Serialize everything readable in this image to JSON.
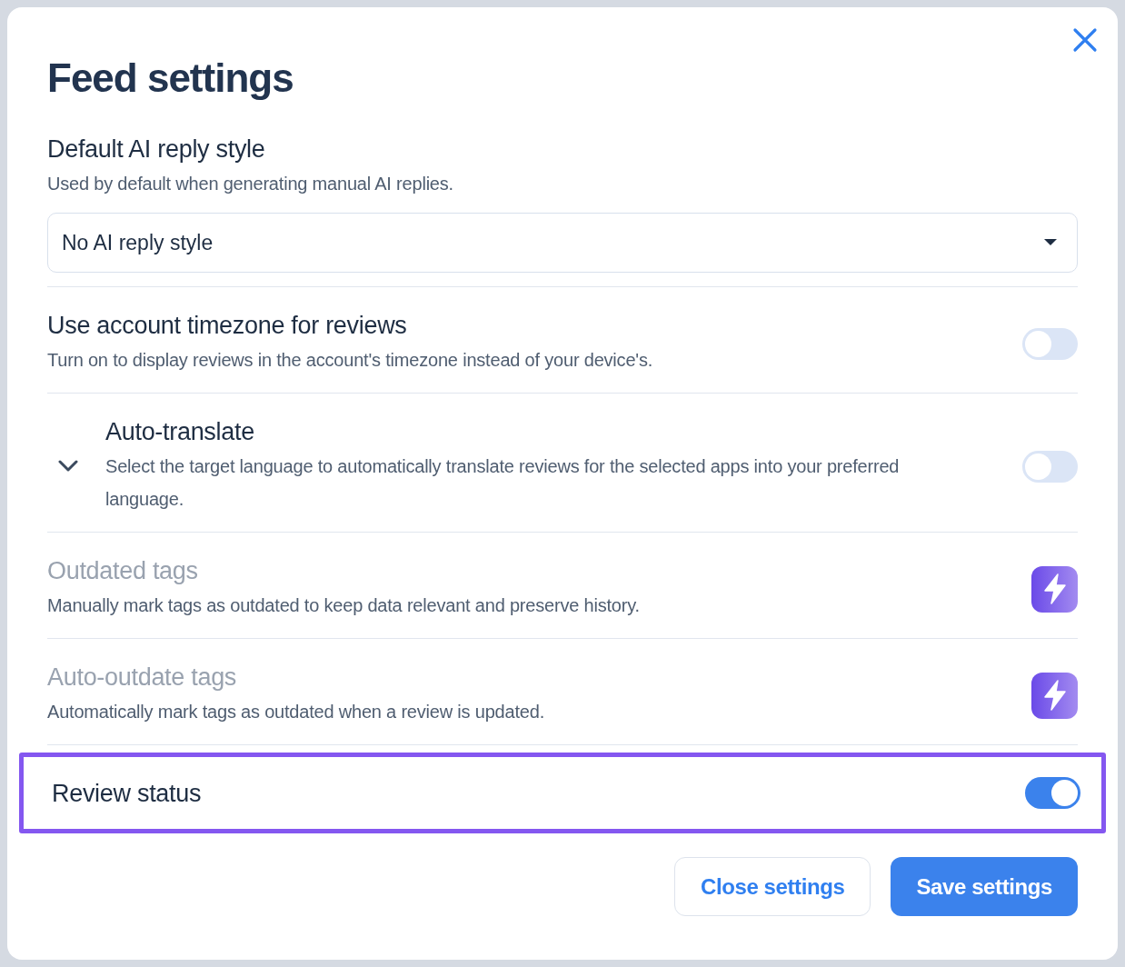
{
  "dialog": {
    "title": "Feed settings"
  },
  "reply_style": {
    "title": "Default AI reply style",
    "description": "Used by default when generating manual AI replies.",
    "value": "No AI reply style"
  },
  "settings": [
    {
      "kind": "toggle",
      "title": "Use account timezone for reviews",
      "description": "Turn on to display reviews in the account's timezone instead of your device's.",
      "on": false,
      "highlighted": false
    },
    {
      "kind": "toggle",
      "title": "Auto-translate",
      "description": "Select the target language to automatically translate reviews for the selected apps into your preferred language.",
      "on": false,
      "expanded": false,
      "highlighted": false
    },
    {
      "kind": "premium",
      "title": "Outdated tags",
      "description": "Manually mark tags as outdated to keep data relevant and preserve history.",
      "highlighted": false
    },
    {
      "kind": "premium",
      "title": "Auto-outdate tags",
      "description": "Automatically mark tags as outdated when a review is updated.",
      "highlighted": false
    },
    {
      "kind": "toggle",
      "title": "Review status",
      "on": true,
      "highlighted": true
    }
  ],
  "buttons": [
    {
      "label": "Close settings",
      "kind": "secondary"
    },
    {
      "label": "Save settings",
      "kind": "primary"
    }
  ]
}
